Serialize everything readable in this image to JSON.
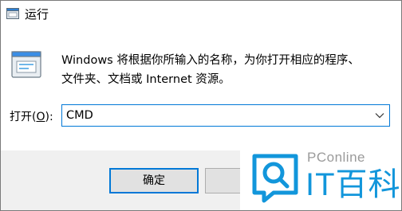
{
  "window": {
    "title": "运行",
    "icon": "run-dialog-icon"
  },
  "description": {
    "line1": "Windows 将根据你所输入的名称，为你打开相应的程序、",
    "line2": "文件夹、文档或 Internet 资源。"
  },
  "open_field": {
    "label_prefix": "打开(",
    "label_key": "O",
    "label_suffix": "):",
    "value": "CMD",
    "dropdown_icon": "chevron-down-icon"
  },
  "buttons": {
    "ok_label": "确定",
    "cancel_label": "取"
  },
  "watermark": {
    "small_text": "PConline",
    "big_text": "IT百科",
    "logo": "search-magnifier-logo"
  },
  "colors": {
    "accent": "#0078d7",
    "footer_bg": "#f0f0f0",
    "watermark_blue": "#1296db"
  }
}
